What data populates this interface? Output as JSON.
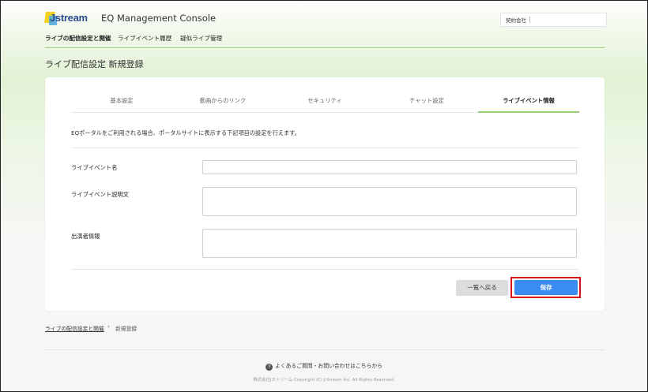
{
  "header": {
    "logo_text": "Jstream",
    "app_title": "EQ Management Console",
    "contract_label": "契約会社"
  },
  "nav": {
    "items": [
      "ライブの配信設定と開催",
      "ライブイベント履歴",
      "疑似ライブ管理"
    ]
  },
  "page_title": "ライブ配信設定 新規登録",
  "tabs": [
    {
      "label": "基本設定"
    },
    {
      "label": "動画からのリンク"
    },
    {
      "label": "セキュリティ"
    },
    {
      "label": "チャット設定"
    },
    {
      "label": "ライブイベント情報",
      "active": true
    }
  ],
  "description": "EQポータルをご利用される場合、ポータルサイトに表示する下記項目の設定を行えます。",
  "form": {
    "event_name_label": "ライブイベント名",
    "event_name_value": "",
    "event_desc_label": "ライブイベント説明文",
    "event_desc_value": "",
    "performer_label": "出演者情報",
    "performer_value": ""
  },
  "buttons": {
    "back_label": "一覧へ戻る",
    "save_label": "保存"
  },
  "breadcrumb": {
    "link": "ライブの配信設定と開催",
    "separator": "›",
    "current": "新規登録"
  },
  "footer": {
    "faq_icon": "?",
    "faq_text": "よくあるご質問・お問い合わせはこちらから",
    "copyright": "株式会社Jストリーム Copyright (C) J-Stream Inc. All Rights Reserved."
  },
  "colors": {
    "accent_green": "#9bcc73",
    "save_blue": "#3b8cf0",
    "highlight_red": "#d61218"
  }
}
